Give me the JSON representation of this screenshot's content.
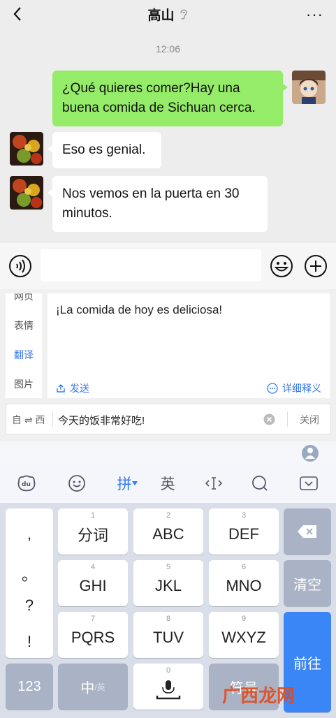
{
  "header": {
    "title": "高山",
    "more": "···"
  },
  "chat": {
    "time": "12:06",
    "messages": [
      {
        "side": "right",
        "line1": "¿Qué quieres comer?Hay una",
        "line2": "buena comida de Sichuan cerca."
      },
      {
        "side": "left",
        "line1": "Eso es genial."
      },
      {
        "side": "left",
        "line1": "Nos vemos en la puerta en 30",
        "line2": "minutos."
      }
    ]
  },
  "translator": {
    "side_menu": [
      "网页",
      "表情",
      "翻译",
      "图片"
    ],
    "result": "¡La comida de hoy es deliciosa!",
    "send_label": "发送",
    "detail_label": "详细释义",
    "direction": "自 ⇌ 西",
    "source_text": "今天的饭非常好吃!",
    "close_label": "关闭"
  },
  "toolbar": {
    "pinyin": "拼",
    "english": "英"
  },
  "keyboard": {
    "punctuation": [
      ",",
      "。",
      "?",
      "!"
    ],
    "keys": [
      {
        "num": "1",
        "label": "分词"
      },
      {
        "num": "2",
        "label": "ABC"
      },
      {
        "num": "3",
        "label": "DEF"
      },
      {
        "num": "4",
        "label": "GHI"
      },
      {
        "num": "5",
        "label": "JKL"
      },
      {
        "num": "6",
        "label": "MNO"
      },
      {
        "num": "7",
        "label": "PQRS"
      },
      {
        "num": "8",
        "label": "TUV"
      },
      {
        "num": "9",
        "label": "WXYZ"
      }
    ],
    "clear_label": "清空",
    "enter_label": "前往",
    "num_label": "123",
    "lang_main": "中",
    "lang_sub": "/英",
    "space_num": "0",
    "symbol_label": "符号"
  },
  "watermark": "广西龙网",
  "colors": {
    "accent": "#3478f6",
    "bubble_green": "#95ec69",
    "enter_blue": "#3a86f6"
  }
}
